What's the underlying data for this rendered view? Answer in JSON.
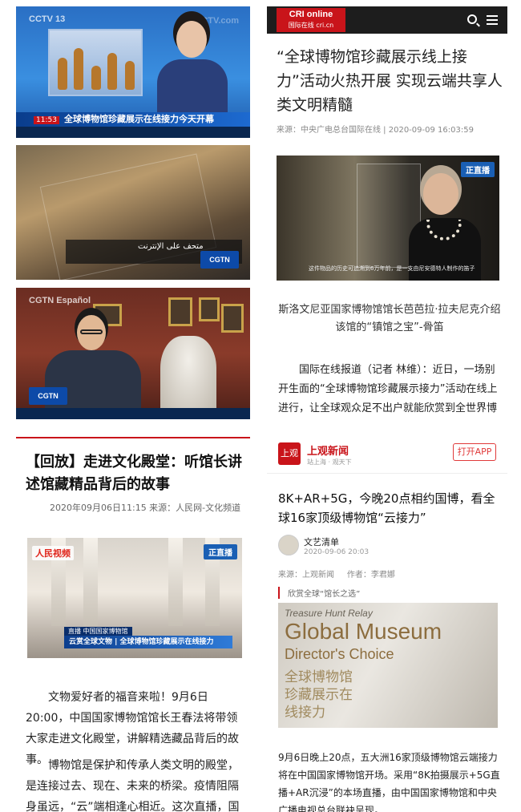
{
  "tv_frames": [
    {
      "channel_logo": "CCTV 13",
      "watermark": "CCTV.com",
      "headline": "全球博物馆珍藏展示在线接力今天开幕",
      "time": "11:53"
    },
    {
      "banner": "متحف على الإنترنت",
      "badge": "CGTN"
    },
    {
      "channel_logo": "CGTN Español",
      "badge": "CGTN"
    }
  ],
  "left_article": {
    "title": "【回放】走进文化殿堂：听馆长讲述馆藏精品背后的故事",
    "meta": "2020年09月06日11:15 来源：人民网-文化频道",
    "video": {
      "logo": "人民视频",
      "live_badge": "正直播",
      "caption_top": "直播 中国国家博物馆",
      "caption": "云赏全球文物 | 全球博物馆珍藏展示在线接力"
    },
    "paragraphs": [
      "文物爱好者的福音来啦！9月6日20:00，中国国家博物馆馆长王春法将带领大家走进文化殿堂，讲解精选藏品背后的故事。",
      "博物馆是保护和传承人类文明的殿堂，是连接过去、现在、未来的桥梁。疫情阻隔身虽远，“云”端相逢心相近。这次直播，国博将采用"
    ]
  },
  "cri_article": {
    "logo_main": "CRI online",
    "logo_sub": "国际在线 cri.cn",
    "title": "“全球博物馆珍藏展示线上接力”活动火热开展 实现云端共享人类文明精髓",
    "meta": "来源：中央广电总台国际在线 | 2020-09-09 16:03:59",
    "photo_badge": "正直播",
    "photo_subtitle": "这件物品的历史可追溯到6万年前，是一支由尼安德特人制作的笛子",
    "photo_caption": "斯洛文尼亚国家博物馆馆长芭芭拉·拉夫尼克介绍该馆的“镇馆之宝”-骨笛",
    "paragraph": "国际在线报道（记者 林维）：近日，一场别开生面的“全球博物馆珍藏展示接力”活动在线上进行，让全球观众足不出户就能欣赏到全世界博"
  },
  "shangguan": {
    "logo_text": "上观",
    "name": "上观新闻",
    "slogan": "站上海 · 观天下",
    "open_app": "打开APP",
    "title": "8K+AR+5G，今晚20点相约国博，看全球16家顶级博物馆“云接力”",
    "author": "文艺清单",
    "date": "2020-09-06 20:03",
    "source": "来源：上观新闻     作者：李君娜",
    "tag": "欣赏全球“馆长之选”",
    "poster": {
      "line1": "Treasure Hunt Relay",
      "line2": "Global Museum",
      "line3": "Director's Choice",
      "line4": "全球博物馆珍藏展示在线接力"
    },
    "paragraph": "9月6日晚上20点，五大洲16家顶级博物馆云端接力将在中国国家博物馆开场。采用“8K拍摄展示+5G直播+AR沉浸”的本场直播，由中国国家博物馆和中央广播电视总台联袂呈现。"
  }
}
